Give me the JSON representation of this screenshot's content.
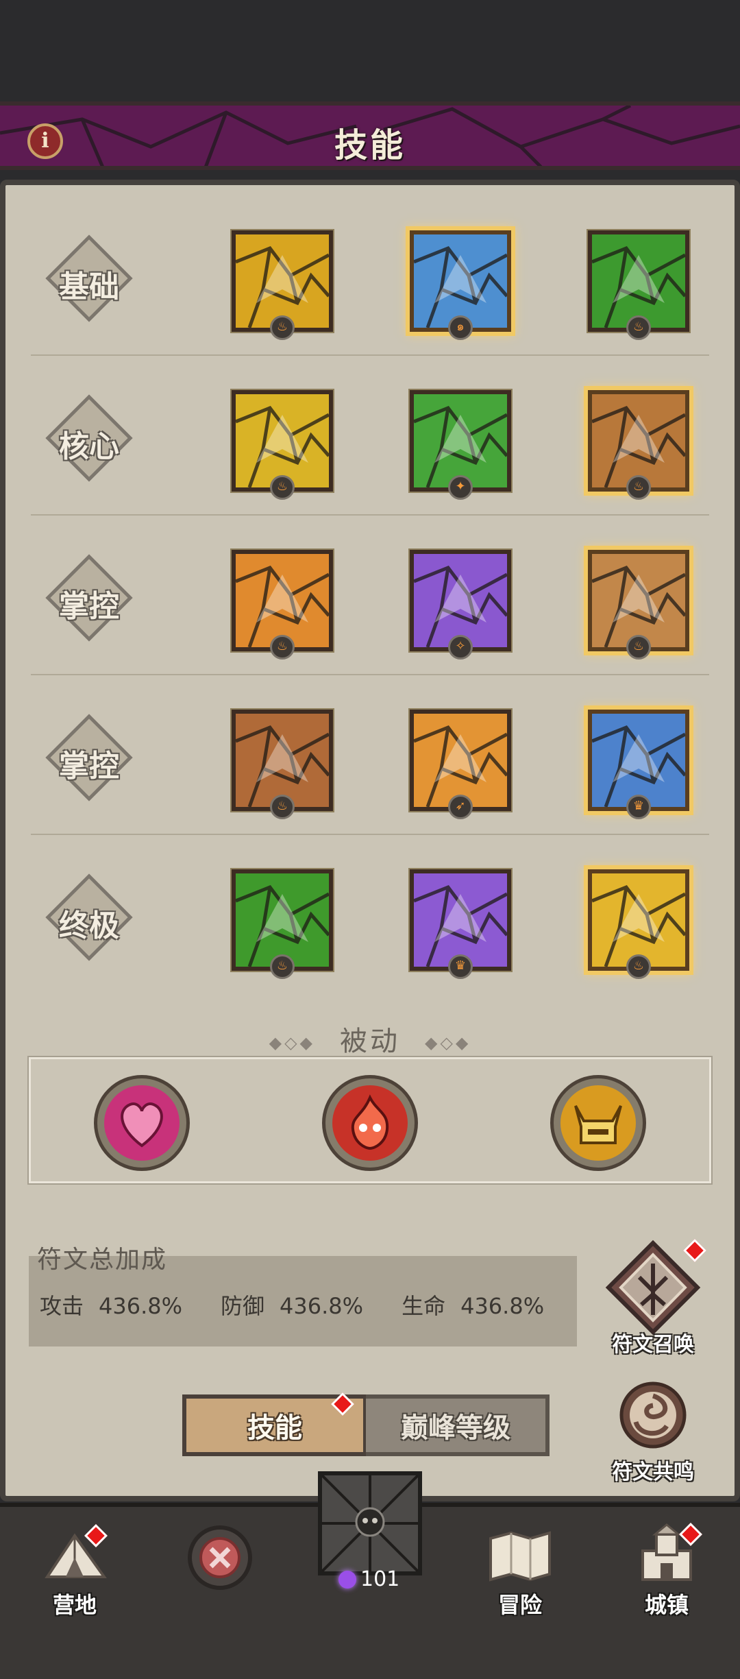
{
  "header": {
    "title": "技能",
    "info_icon": "info-icon"
  },
  "skill_rows": [
    {
      "label": "基础",
      "skills": [
        {
          "icon": "golden-axe-icon",
          "rune": "fire-rune",
          "color": "#d8a520",
          "selected": false
        },
        {
          "icon": "ice-axe-icon",
          "rune": "wind-rune",
          "color": "#4e8fd0",
          "selected": true
        },
        {
          "icon": "wind-strike-icon",
          "rune": "fire-rune",
          "color": "#3d9a2f",
          "selected": false
        }
      ]
    },
    {
      "label": "核心",
      "skills": [
        {
          "icon": "whirlwind-icon",
          "rune": "fire-rune",
          "color": "#d9b326",
          "selected": false
        },
        {
          "icon": "green-slash-icon",
          "rune": "earth-rune",
          "color": "#46a53a",
          "selected": false
        },
        {
          "icon": "hammer-icon",
          "rune": "fire-rune",
          "color": "#b8783a",
          "selected": true
        }
      ]
    },
    {
      "label": "掌控",
      "skills": [
        {
          "icon": "comet-icon",
          "rune": "fire-rune",
          "color": "#e08a2e",
          "selected": false
        },
        {
          "icon": "purple-burst-icon",
          "rune": "spark-rune",
          "color": "#8a58cf",
          "selected": false
        },
        {
          "icon": "earth-pillar-icon",
          "rune": "fire-rune",
          "color": "#c2874a",
          "selected": true
        }
      ]
    },
    {
      "label": "掌控",
      "skills": [
        {
          "icon": "earth-totem-icon",
          "rune": "fire-rune",
          "color": "#b06a38",
          "selected": false
        },
        {
          "icon": "roar-icon",
          "rune": "arrow-rune",
          "color": "#e39434",
          "selected": false
        },
        {
          "icon": "frost-roar-icon",
          "rune": "crown-rune",
          "color": "#4d82cc",
          "selected": true
        }
      ]
    },
    {
      "label": "终极",
      "skills": [
        {
          "icon": "tornado-icon",
          "rune": "fire-rune",
          "color": "#3f9a2c",
          "selected": false
        },
        {
          "icon": "demon-icon",
          "rune": "crown-rune",
          "color": "#8c5ad2",
          "selected": false
        },
        {
          "icon": "golden-titan-icon",
          "rune": "fire-rune",
          "color": "#e3b52d",
          "selected": true
        }
      ]
    }
  ],
  "passive": {
    "title": "被动",
    "items": [
      {
        "icon": "heart-icon",
        "color": "#c8327a"
      },
      {
        "icon": "fire-spirit-icon",
        "color": "#c73228"
      },
      {
        "icon": "horned-helmet-icon",
        "color": "#d99b20"
      }
    ]
  },
  "rune_bonus": {
    "title": "符文总加成",
    "attack_label": "攻击",
    "attack_value": "436.8%",
    "defense_label": "防御",
    "defense_value": "436.8%",
    "life_label": "生命",
    "life_value": "436.8%"
  },
  "side_buttons": {
    "summon_label": "符文召唤",
    "resonance_label": "符文共鸣"
  },
  "tabs": {
    "skill_label": "技能",
    "peak_label": "巅峰等级"
  },
  "nav": {
    "camp_label": "营地",
    "adventure_label": "冒险",
    "town_label": "城镇",
    "gem_count": "101"
  }
}
